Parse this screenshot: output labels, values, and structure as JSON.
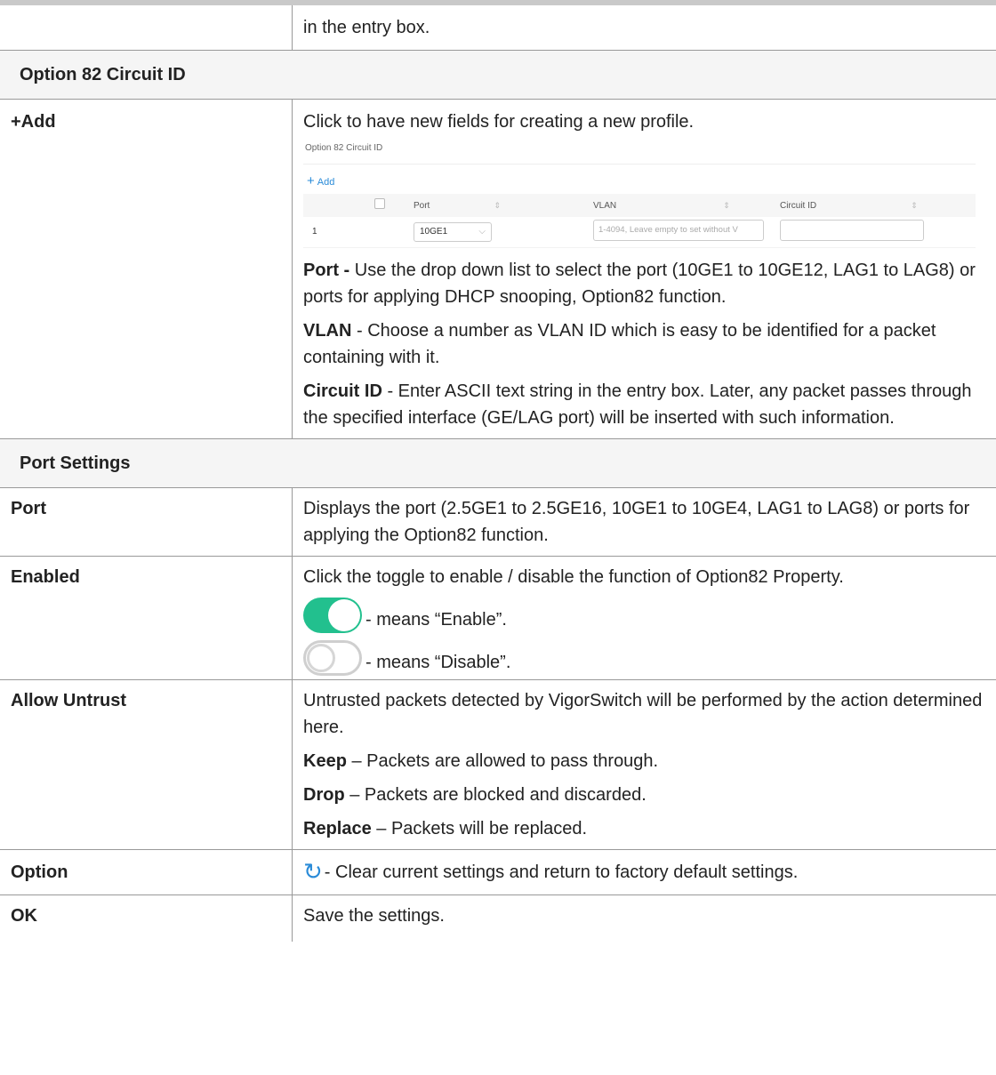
{
  "top_row": {
    "desc": "in the entry box."
  },
  "section1": {
    "title": "Option 82 Circuit ID",
    "add": {
      "label": "+Add",
      "desc": "Click to have new fields for creating a new profile."
    },
    "screenshot": {
      "title": "Option 82 Circuit ID",
      "add_label": "Add",
      "columns": [
        "Port",
        "VLAN",
        "Circuit ID"
      ],
      "row": {
        "index": "1",
        "port": "10GE1",
        "vlan_placeholder": "1-4094, Leave empty to set without V"
      }
    },
    "port": {
      "term": "Port -",
      "text": " Use the drop down list to select the port (10GE1 to 10GE12, LAG1 to LAG8) or ports for applying DHCP snooping, Option82 function."
    },
    "vlan": {
      "term": "VLAN",
      "text": " - Choose a number as VLAN ID which is easy to be identified for a packet containing with it."
    },
    "circuit": {
      "term": "Circuit ID",
      "text": " - Enter ASCII text string in the entry box. Later, any packet passes through the specified interface (GE/LAG port) will be inserted with such information."
    }
  },
  "section2": {
    "title": "Port Settings",
    "port": {
      "label": "Port",
      "desc": "Displays the port (2.5GE1 to 2.5GE16, 10GE1 to 10GE4, LAG1 to LAG8) or ports for applying the Option82 function."
    },
    "enabled": {
      "label": "Enabled",
      "desc": "Click the toggle to enable / disable the function of Option82 Property.",
      "on_text": "- means “Enable”.",
      "off_text": "- means “Disable”."
    },
    "allow": {
      "label": "Allow Untrust",
      "desc": "Untrusted packets detected by VigorSwitch will be performed by the action determined here.",
      "keep_term": "Keep",
      "keep_text": " – Packets are allowed to pass through.",
      "drop_term": "Drop",
      "drop_text": " – Packets are blocked and discarded.",
      "replace_term": "Replace",
      "replace_text": " – Packets will be replaced."
    },
    "option": {
      "label": "Option",
      "desc": "- Clear current settings and return to factory default settings."
    },
    "ok": {
      "label": "OK",
      "desc": "Save the settings."
    }
  }
}
